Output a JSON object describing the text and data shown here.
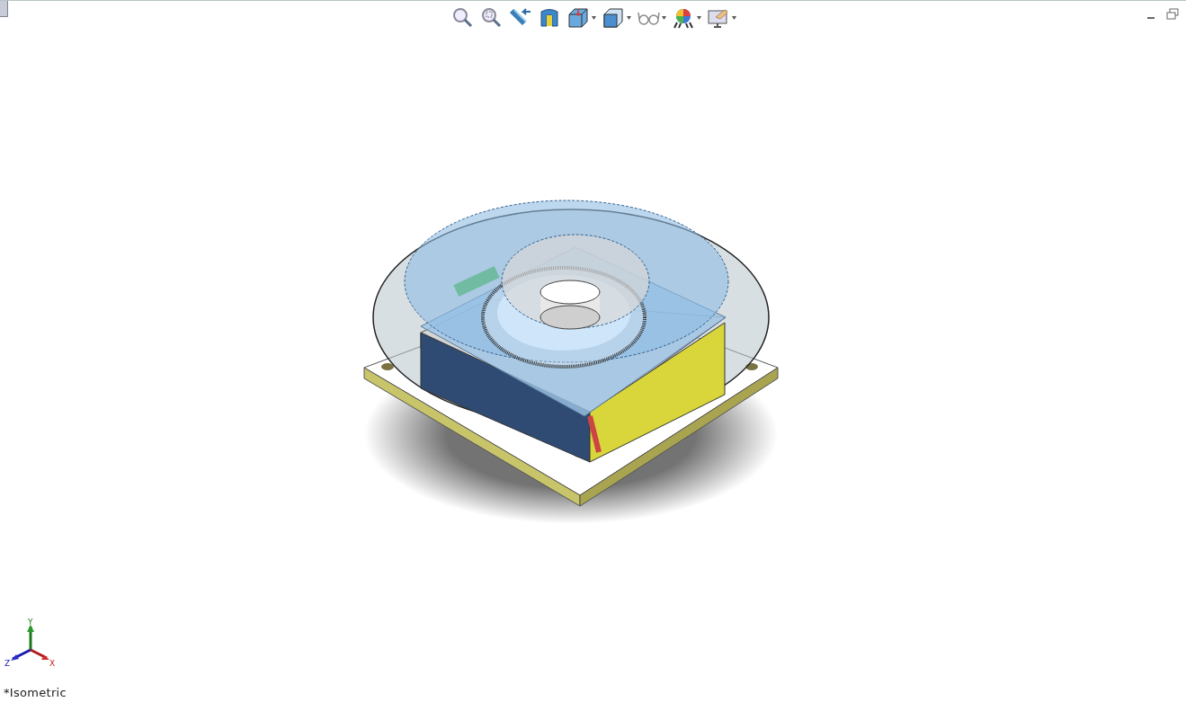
{
  "toolbar": [
    {
      "kind": "zoom-fit",
      "has_menu": false
    },
    {
      "kind": "zoom-area",
      "has_menu": false
    },
    {
      "kind": "previous-view",
      "has_menu": false
    },
    {
      "kind": "section",
      "has_menu": false
    },
    {
      "kind": "orientation",
      "has_menu": true
    },
    {
      "kind": "display-style",
      "has_menu": true
    },
    {
      "kind": "hide-show",
      "has_menu": true
    },
    {
      "kind": "appearance",
      "has_menu": true
    },
    {
      "kind": "scene",
      "has_menu": true
    }
  ],
  "triad": {
    "x": "X",
    "y": "Y",
    "z": "Z"
  },
  "view_label": "*Isometric"
}
